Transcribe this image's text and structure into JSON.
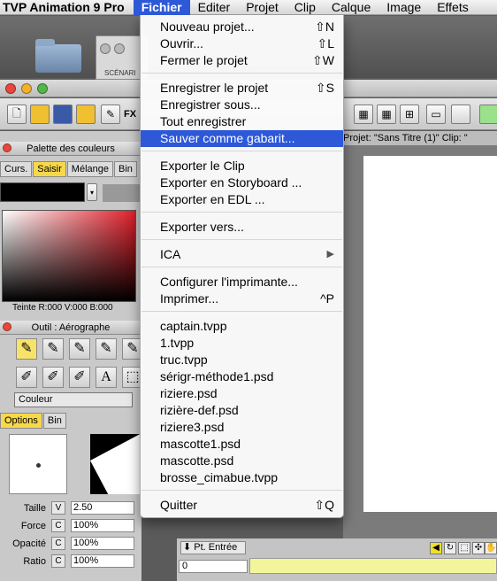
{
  "menubar": {
    "app_name": "TVP Animation 9 Pro",
    "menus": [
      "Fichier",
      "Editer",
      "Projet",
      "Clip",
      "Calque",
      "Image",
      "Effets"
    ],
    "active_menu": "Fichier"
  },
  "background": {
    "scenario_label": "SCÉNARI",
    "toolbar_fx": "FX"
  },
  "fichier_menu": {
    "items": [
      {
        "label": "Nouveau projet...",
        "shortcut": "⇧N"
      },
      {
        "label": "Ouvrir...",
        "shortcut": "⇧L"
      },
      {
        "label": "Fermer le projet",
        "shortcut": "⇧W"
      },
      {
        "label": "Enregistrer le projet",
        "shortcut": "⇧S"
      },
      {
        "label": "Enregistrer sous...",
        "shortcut": ""
      },
      {
        "label": "Tout enregistrer",
        "shortcut": ""
      },
      {
        "label": "Sauver comme gabarit...",
        "shortcut": ""
      },
      {
        "label": "Exporter le Clip",
        "shortcut": ""
      },
      {
        "label": "Exporter en Storyboard ...",
        "shortcut": ""
      },
      {
        "label": "Exporter en EDL ...",
        "shortcut": ""
      },
      {
        "label": "Exporter vers...",
        "shortcut": ""
      },
      {
        "label": "ICA",
        "shortcut": ""
      },
      {
        "label": "Configurer l'imprimante...",
        "shortcut": ""
      },
      {
        "label": "Imprimer...",
        "shortcut": "^P"
      },
      {
        "label": "captain.tvpp",
        "shortcut": ""
      },
      {
        "label": "1.tvpp",
        "shortcut": ""
      },
      {
        "label": "truc.tvpp",
        "shortcut": ""
      },
      {
        "label": "sérigr-méthode1.psd",
        "shortcut": ""
      },
      {
        "label": "riziere.psd",
        "shortcut": ""
      },
      {
        "label": "rizière-def.psd",
        "shortcut": ""
      },
      {
        "label": "riziere3.psd",
        "shortcut": ""
      },
      {
        "label": "mascotte1.psd",
        "shortcut": ""
      },
      {
        "label": "mascotte.psd",
        "shortcut": ""
      },
      {
        "label": "brosse_cimabue.tvpp",
        "shortcut": ""
      },
      {
        "label": "Quitter",
        "shortcut": "⇧Q"
      }
    ],
    "highlighted": "Sauver comme gabarit...",
    "submenu_item": "ICA"
  },
  "palette": {
    "title": "Palette des couleurs",
    "tabs": [
      "Curs.",
      "Saisir",
      "Mélange",
      "Bin"
    ],
    "selected_tab": "Saisir",
    "teinte": "Teinte R:000 V:000 B:000"
  },
  "tool_panel": {
    "title": "Outil : Aérographe",
    "mode": "Couleur",
    "tabs": [
      "Options",
      "Bin"
    ],
    "params": [
      {
        "label": "Taille",
        "mode": "V",
        "value": "2.50"
      },
      {
        "label": "Force",
        "mode": "C",
        "value": "100%"
      },
      {
        "label": "Opacité",
        "mode": "C",
        "value": "100%"
      },
      {
        "label": "Ratio",
        "mode": "C",
        "value": "100%"
      }
    ]
  },
  "project": {
    "info": "Projet: \"Sans Titre (1)\"  Clip: \"",
    "pt_entree": "Pt. Entrée",
    "frame": "0"
  }
}
